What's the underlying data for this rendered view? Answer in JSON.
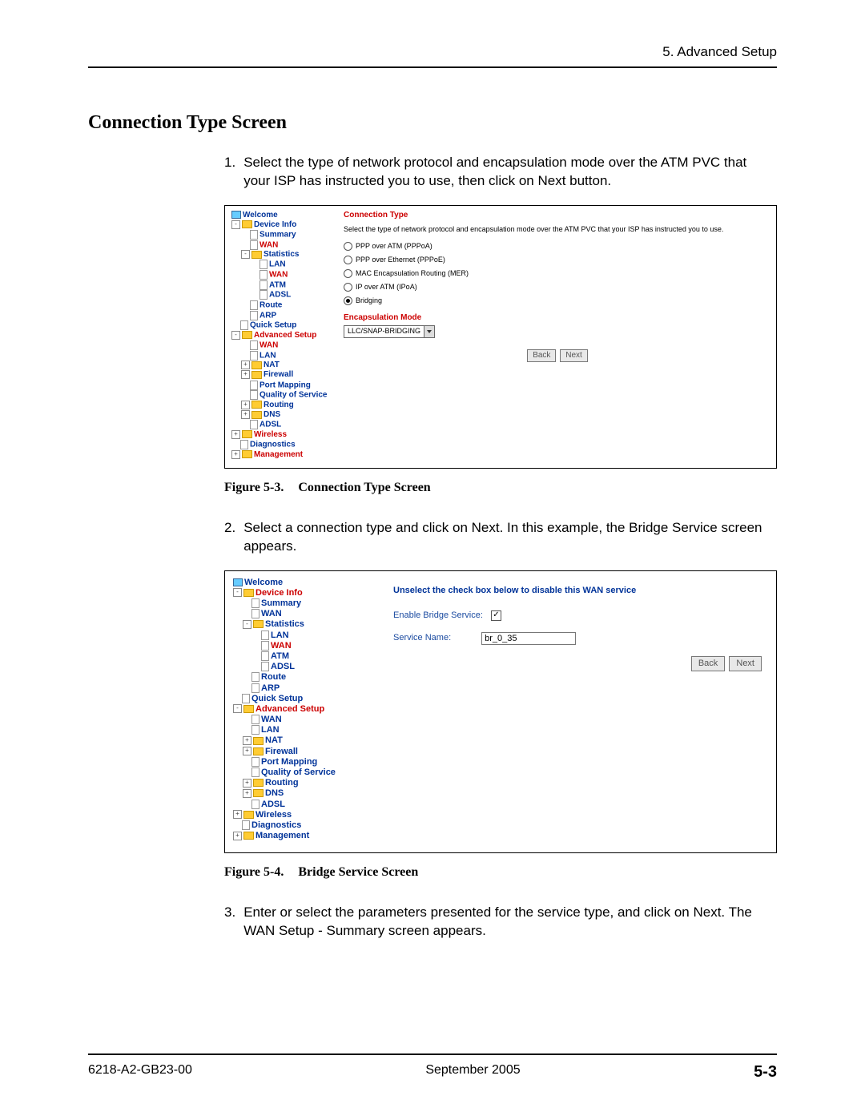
{
  "header": {
    "chapter": "5. Advanced Setup"
  },
  "section_title": "Connection Type Screen",
  "steps": {
    "s1": {
      "num": "1.",
      "text": "Select the type of network protocol and encapsulation mode over the ATM PVC that your ISP has instructed you to use, then click on Next button."
    },
    "s2": {
      "num": "2.",
      "text": "Select a connection type and click on Next. In this example, the Bridge Service screen appears."
    },
    "s3": {
      "num": "3.",
      "text": "Enter or select the parameters presented for the service type, and click on Next. The WAN Setup - Summary screen appears."
    }
  },
  "fig1": {
    "label": "Figure 5-3.",
    "title": "Connection Type Screen"
  },
  "fig2": {
    "label": "Figure 5-4.",
    "title": "Bridge Service Screen"
  },
  "tree": {
    "welcome": "Welcome",
    "device_info": "Device Info",
    "summary": "Summary",
    "wan": "WAN",
    "statistics": "Statistics",
    "lan": "LAN",
    "atm": "ATM",
    "adsl": "ADSL",
    "route": "Route",
    "arp": "ARP",
    "quick_setup": "Quick Setup",
    "advanced_setup": "Advanced Setup",
    "nat": "NAT",
    "firewall": "Firewall",
    "port_mapping": "Port Mapping",
    "qos": "Quality of Service",
    "routing": "Routing",
    "dns": "DNS",
    "wireless": "Wireless",
    "diagnostics": "Diagnostics",
    "management": "Management"
  },
  "conn_panel": {
    "title": "Connection Type",
    "instruction": "Select the type of network protocol and encapsulation mode over the ATM PVC that your ISP has instructed you to use.",
    "radios": {
      "pppoa": "PPP over ATM (PPPoA)",
      "pppoe": "PPP over Ethernet (PPPoE)",
      "mer": "MAC Encapsulation Routing (MER)",
      "ipoa": "IP over ATM (IPoA)",
      "bridging": "Bridging"
    },
    "encap_label": "Encapsulation Mode",
    "encap_value": "LLC/SNAP-BRIDGING",
    "back": "Back",
    "next": "Next"
  },
  "bridge_panel": {
    "title": "Unselect the check box below to disable this WAN service",
    "enable_label": "Enable Bridge Service:",
    "service_name_label": "Service Name:",
    "service_name_value": "br_0_35",
    "back": "Back",
    "next": "Next"
  },
  "footer": {
    "doc_id": "6218-A2-GB23-00",
    "date": "September 2005",
    "page": "5-3"
  }
}
